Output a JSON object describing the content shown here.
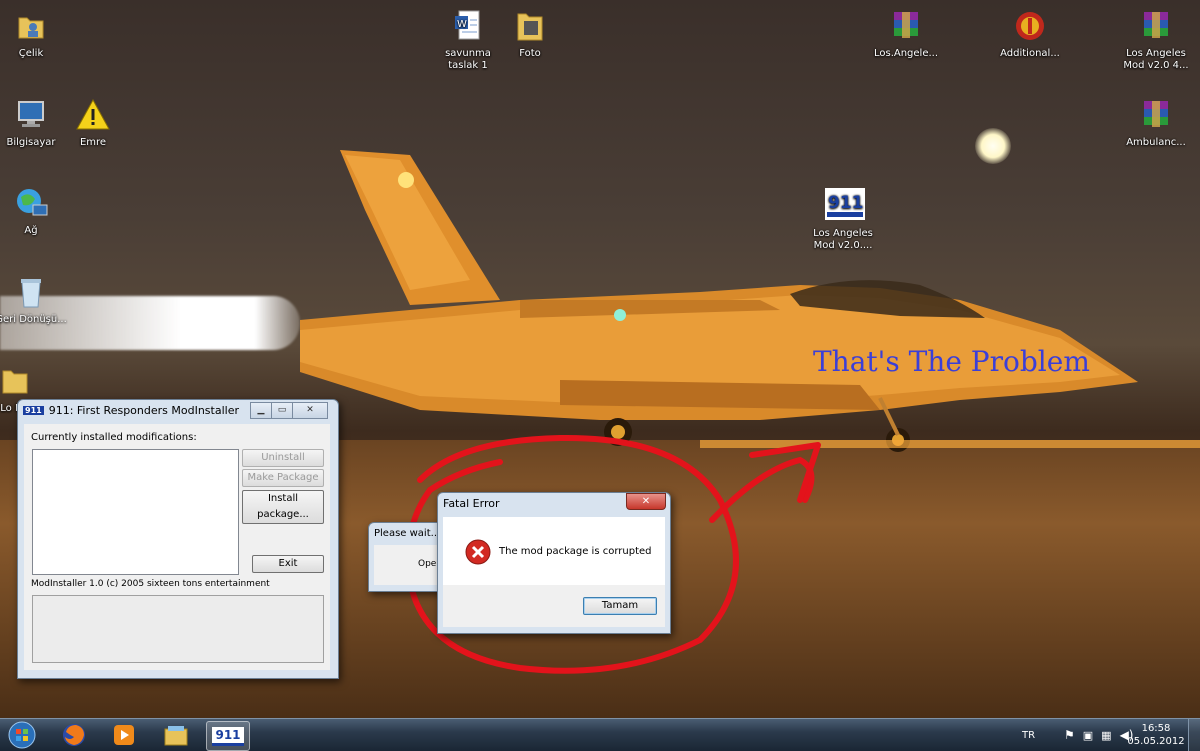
{
  "desktop": {
    "overlay_text": "That's The Problem",
    "icons": [
      {
        "label": "Çelik",
        "icon": "user-folder-icon"
      },
      {
        "label": "Bilgisayar",
        "icon": "computer-icon"
      },
      {
        "label": "Emre",
        "icon": "warning-icon"
      },
      {
        "label": "Ağ",
        "icon": "network-icon"
      },
      {
        "label": "Geri Dönüşü...",
        "icon": "recycle-bin-icon"
      },
      {
        "label": "Lo Mo",
        "icon": "folder-icon"
      },
      {
        "label": "savunma taslak 1",
        "icon": "word-document-icon"
      },
      {
        "label": "Foto",
        "icon": "folder-icon"
      },
      {
        "label": "Los.Angele...",
        "icon": "winrar-icon"
      },
      {
        "label": "Additional...",
        "icon": "firefighter-badge-icon"
      },
      {
        "label": "Los Angeles Mod v2.0 4...",
        "icon": "winrar-icon"
      },
      {
        "label": "Ambulanc...",
        "icon": "winrar-icon"
      },
      {
        "label": "Los Angeles Mod v2.0....",
        "icon": "911-app-icon"
      }
    ]
  },
  "modinstaller": {
    "title": "911: First Responders ModInstaller",
    "app_icon": "911",
    "installed_label": "Currently installed modifications:",
    "uninstall_label": "Uninstall",
    "make_package_label": "Make Package",
    "install_package_label": "Install package...",
    "exit_label": "Exit",
    "version_label": "ModInstaller 1.0 (c) 2005 sixteen tons entertainment"
  },
  "wait_dialog": {
    "title": "Please wait...",
    "body_text": "Oper"
  },
  "fatal_error": {
    "title": "Fatal Error",
    "message": "The mod package is corrupted",
    "ok_label": "Tamam",
    "close_glyph": "✕"
  },
  "taskbar": {
    "start_icon": "windows-start-orb-icon",
    "pinned": [
      "firefox-icon",
      "media-player-icon",
      "explorer-icon",
      "911-app-icon"
    ],
    "active_app_label": "911",
    "language": "TR",
    "time": "16:58",
    "date": "05.05.2012"
  },
  "colors": {
    "overlay_text": "#3b3fd8",
    "annotation_red": "#e3131b",
    "taskbar": "#2b3a4c"
  }
}
